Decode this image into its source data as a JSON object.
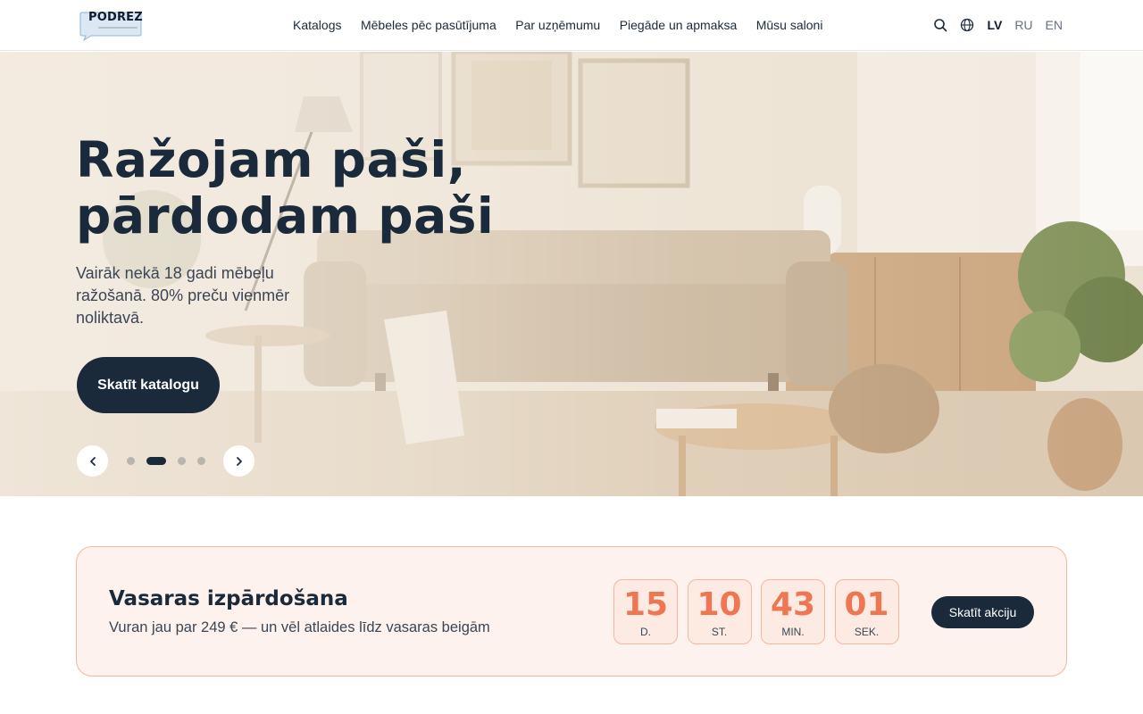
{
  "header": {
    "logo_text": "PODREZ",
    "nav": [
      "Katalogs",
      "Mēbeles pēc pasūtījuma",
      "Par uzņēmumu",
      "Piegāde un apmaksa",
      "Mūsu saloni"
    ],
    "icons": [
      "search-icon",
      "globe-icon"
    ],
    "languages": [
      {
        "code": "LV",
        "active": true
      },
      {
        "code": "RU",
        "active": false
      },
      {
        "code": "EN",
        "active": false
      }
    ]
  },
  "hero": {
    "title": "Ražojam paši, pārdodam paši",
    "subtitle": "Vairāk nekā 18 gadi mēbeļu ražošanā. 80% preču vienmēr noliktavā.",
    "button_label": "Skatīt katalogu",
    "slides_total": 4,
    "active_slide": 2
  },
  "promo": {
    "title": "Vasaras izpārdošana",
    "text": "Vuran jau par 249 € — un vēl atlaides līdz vasaras beigām",
    "countdown": [
      {
        "value": "15",
        "unit": "D."
      },
      {
        "value": "10",
        "unit": "ST."
      },
      {
        "value": "43",
        "unit": "MIN."
      },
      {
        "value": "01",
        "unit": "SEK."
      }
    ],
    "button_label": "Skatīt akciju"
  },
  "colors": {
    "primary_dark": "#1b2a3a",
    "accent": "#ef7652",
    "promo_bg": "#fdf2ed",
    "promo_border": "#f3b8a1"
  }
}
